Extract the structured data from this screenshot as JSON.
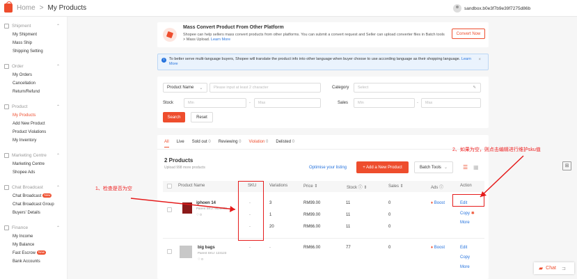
{
  "topbar": {
    "home": "Home",
    "separator": ">",
    "current": "My Products",
    "account": "sandbox.b0e3f7b9e39f7275d86b"
  },
  "sidebar": [
    {
      "title": "Shipment",
      "items": [
        "My Shipment",
        "Mass Ship",
        "Shipping Setting"
      ]
    },
    {
      "title": "Order",
      "items": [
        "My Orders",
        "Cancellation",
        "Return/Refund"
      ]
    },
    {
      "title": "Product",
      "items": [
        "My Products",
        "Add New Product",
        "Product Violations",
        "My Inventory"
      ]
    },
    {
      "title": "Marketing Centre",
      "items": [
        "Marketing Centre",
        "Shopee Ads"
      ]
    },
    {
      "title": "Chat Broadcast",
      "items": [
        "Chat Broadcast",
        "Chat Broadcast Group",
        "Buyers' Details"
      ]
    },
    {
      "title": "Finance",
      "items": [
        "My Income",
        "My Balance",
        "Fast Escrow",
        "Bank Accounts"
      ]
    }
  ],
  "badge_new": "New",
  "promo": {
    "title": "Mass Convert Product From Other Platform",
    "desc": "Shopee can help sellers mass convert products from other platforms. You can submit a convert request and Seller can upload converter files in Batch tools > Mass Upload.",
    "learn": "Learn More",
    "button": "Convert Now"
  },
  "notice": {
    "text": "To better serve multi-language buyers, Shopee will translate the product info into other language when buyer choose to use according language as their shopping language.",
    "learn": "Learn More",
    "close": "×"
  },
  "filter": {
    "product_name_label": "Product Name",
    "name_placeholder": "Please input at least 2 character",
    "category_label": "Category",
    "category_placeholder": "Select",
    "stock_label": "Stock",
    "min": "Min",
    "max": "Max",
    "sales_label": "Sales",
    "dash": "-",
    "search": "Search",
    "reset": "Reset"
  },
  "tabs": [
    {
      "label": "All",
      "count": ""
    },
    {
      "label": "Live",
      "count": ""
    },
    {
      "label": "Sold out",
      "count": "0"
    },
    {
      "label": "Reviewing",
      "count": "0"
    },
    {
      "label": "Violation",
      "count": "0"
    },
    {
      "label": "Delisted",
      "count": "0"
    }
  ],
  "list": {
    "title": "2 Products",
    "subtitle": "Upload 998 more products",
    "optimise": "Optimise your listing",
    "add_button": "+ Add a New Product",
    "batch": "Batch Tools"
  },
  "columns": {
    "name": "Product Name",
    "sku": "SKU",
    "variations": "Variations",
    "price": "Price",
    "stock": "Stock",
    "sales": "Sales",
    "ads": "Ads",
    "action": "Action"
  },
  "products": [
    {
      "name": "iphoen 14",
      "parent_sku": "Parent SKU: 9628888",
      "likes": "0",
      "sku": [
        "-",
        "-",
        "-"
      ],
      "variations": [
        "3",
        "1",
        "20"
      ],
      "prices": [
        "RM99.00",
        "RM99.00",
        "RM66.00"
      ],
      "stock": [
        "11",
        "11",
        "11"
      ],
      "sales": [
        "0",
        "0",
        "0"
      ],
      "ads": "Boost",
      "actions": [
        "Edit",
        "Copy",
        "More"
      ]
    },
    {
      "name": "big bags",
      "parent_sku": "Parent SKU: 123123",
      "likes": "0",
      "sku": "-",
      "variations": "-",
      "price": "RM66.00",
      "stock": "77",
      "sales": "0",
      "ads": "Boost",
      "actions": [
        "Edit",
        "Copy",
        "More"
      ]
    }
  ],
  "annotations": {
    "check": "1、检查是否为空",
    "edit": "2、如果为空，则点击编辑进行维护sku值"
  },
  "chat": "Chat"
}
